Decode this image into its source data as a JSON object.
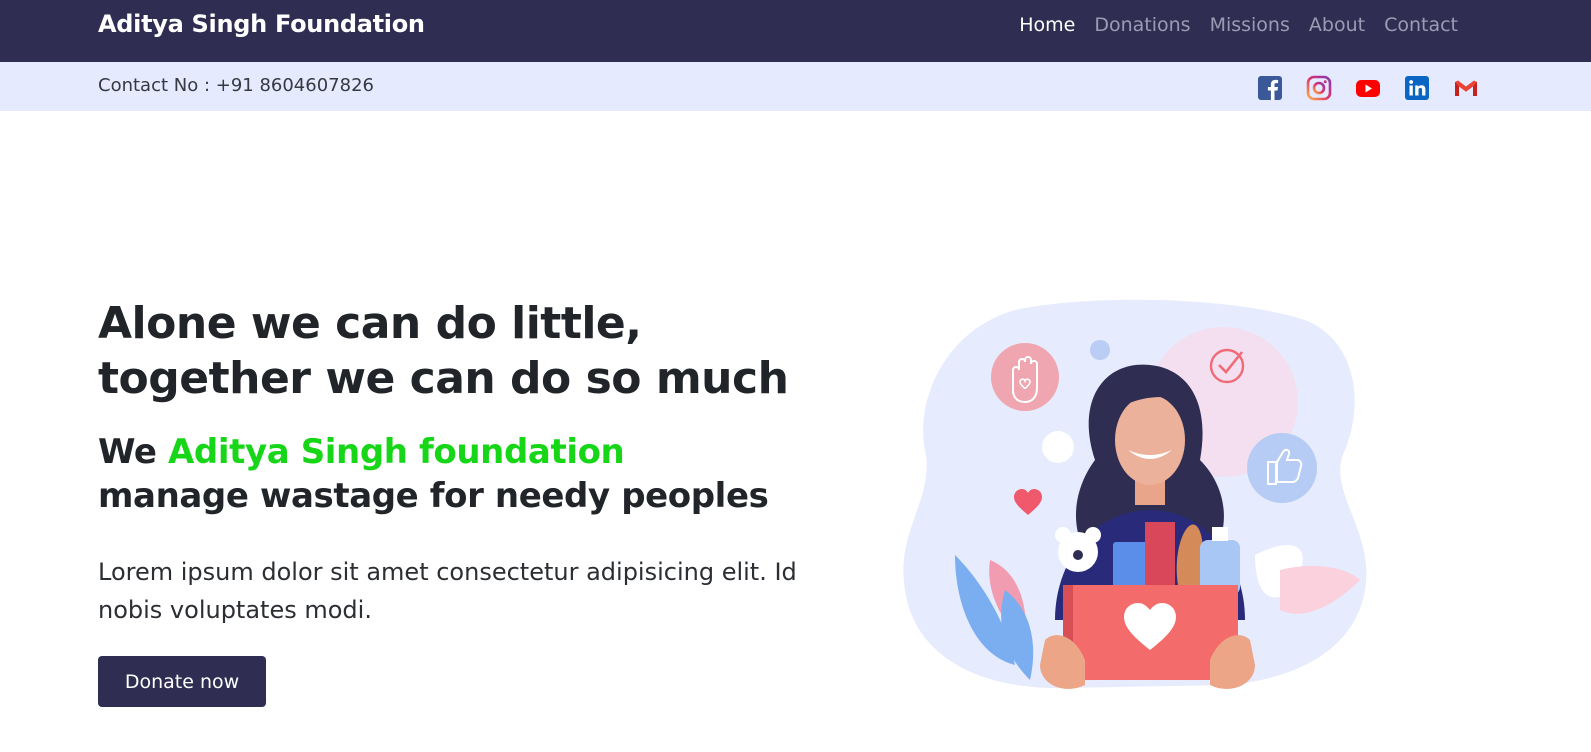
{
  "navbar": {
    "brand": "Aditya Singh Foundation",
    "links": [
      {
        "label": "Home",
        "active": true
      },
      {
        "label": "Donations",
        "active": false
      },
      {
        "label": "Missions",
        "active": false
      },
      {
        "label": "About",
        "active": false
      },
      {
        "label": "Contact",
        "active": false
      }
    ]
  },
  "contact_bar": {
    "contact_text": "Contact No : +91 8604607826",
    "socials": [
      "facebook-icon",
      "instagram-icon",
      "youtube-icon",
      "linkedin-icon",
      "gmail-icon"
    ]
  },
  "hero": {
    "title_line1": "Alone we can do little,",
    "title_line2": "together we can do so much",
    "sub_prefix": "We ",
    "sub_highlight": "Aditya Singh foundation",
    "sub_line2": "manage wastage for needy peoples",
    "description": "Lorem ipsum dolor sit amet consectetur adipisicing elit. Id nobis voluptates modi.",
    "button_label": "Donate now"
  },
  "colors": {
    "navbar_bg": "#2f2e52",
    "contactbar_bg": "#e5eaff",
    "highlight_green": "#17d617",
    "button_bg": "#2f2e52"
  }
}
